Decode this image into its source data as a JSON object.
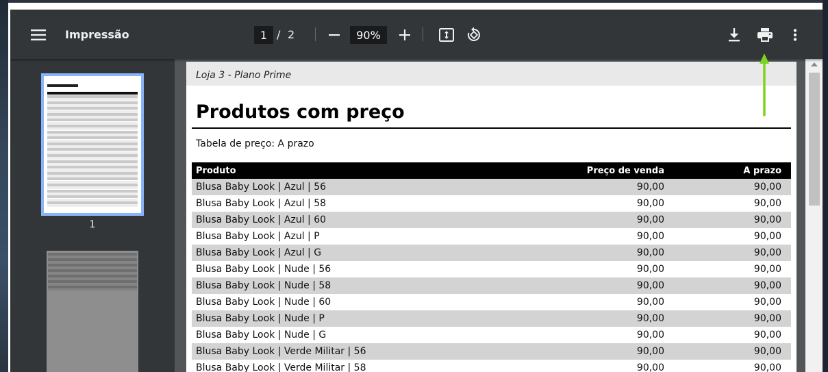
{
  "toolbar": {
    "title": "Impressão",
    "page_current": "1",
    "page_separator": "/",
    "page_total": "2",
    "zoom": "90%"
  },
  "icons": {
    "menu": "menu-icon",
    "zoom_out": "minus-icon",
    "zoom_in": "plus-icon",
    "fit": "fit-page-icon",
    "rotate": "rotate-icon",
    "download": "download-icon",
    "print": "print-icon",
    "more": "more-vert-icon"
  },
  "sidebar": {
    "thumb1_label": "1"
  },
  "document": {
    "header": "Loja 3 - Plano Prime",
    "title": "Produtos com preço",
    "subtitle": "Tabela de preço: A prazo",
    "columns": [
      "Produto",
      "Preço de venda",
      "A prazo"
    ],
    "rows": [
      [
        "Blusa Baby Look | Azul | 56",
        "90,00",
        "90,00"
      ],
      [
        "Blusa Baby Look | Azul | 58",
        "90,00",
        "90,00"
      ],
      [
        "Blusa Baby Look | Azul | 60",
        "90,00",
        "90,00"
      ],
      [
        "Blusa Baby Look | Azul | P",
        "90,00",
        "90,00"
      ],
      [
        "Blusa Baby Look | Azul | G",
        "90,00",
        "90,00"
      ],
      [
        "Blusa Baby Look | Nude | 56",
        "90,00",
        "90,00"
      ],
      [
        "Blusa Baby Look | Nude | 58",
        "90,00",
        "90,00"
      ],
      [
        "Blusa Baby Look | Nude | 60",
        "90,00",
        "90,00"
      ],
      [
        "Blusa Baby Look | Nude | P",
        "90,00",
        "90,00"
      ],
      [
        "Blusa Baby Look | Nude | G",
        "90,00",
        "90,00"
      ],
      [
        "Blusa Baby Look | Verde Militar | 56",
        "90,00",
        "90,00"
      ],
      [
        "Blusa Baby Look | Verde Militar | 58",
        "90,00",
        "90,00"
      ]
    ]
  },
  "colors": {
    "toolbar_bg": "#323639",
    "viewer_bg": "#525659",
    "annotation_arrow": "#7ed321",
    "thumbnail_selected": "#8ab4f8"
  }
}
